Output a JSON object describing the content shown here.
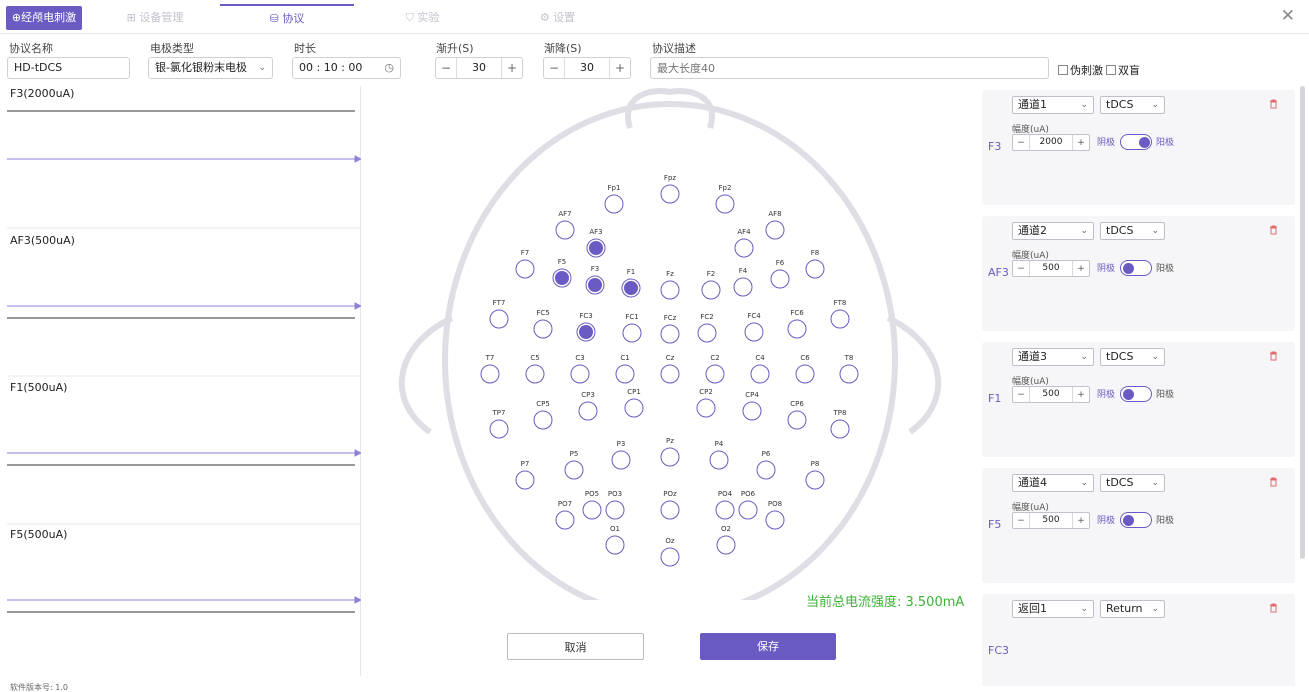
{
  "tabs": {
    "logo": "⊕经颅电刺激",
    "device": "⊞ 设备管理",
    "protocol": "⛁ 协议",
    "experiment": "⛉ 实验",
    "settings": "⚙ 设置",
    "close": "✕"
  },
  "form": {
    "name_label": "协议名称",
    "name_value": "HD-tDCS",
    "electrode_label": "电极类型",
    "electrode_value": "银-氯化银粉末电极",
    "duration_label": "时长",
    "duration_value": "00 : 10 : 00",
    "rampup_label": "渐升(S)",
    "rampup_value": "30",
    "rampdown_label": "渐降(S)",
    "rampdown_value": "30",
    "desc_label": "协议描述",
    "desc_placeholder": "最大长度40",
    "sham_label": "伪刺激",
    "double_blind_label": "双盲",
    "minus": "−",
    "plus": "+"
  },
  "waves": [
    {
      "label": "F3(2000uA)"
    },
    {
      "label": "AF3(500uA)"
    },
    {
      "label": "F1(500uA)"
    },
    {
      "label": "F5(500uA)"
    }
  ],
  "active_color": "#6a5bc2",
  "electrodes": [
    {
      "n": "Fpz",
      "a": false
    },
    {
      "n": "Fp1",
      "a": false
    },
    {
      "n": "Fp2",
      "a": false
    },
    {
      "n": "AF7",
      "a": false
    },
    {
      "n": "AF8",
      "a": false
    },
    {
      "n": "AF3",
      "a": true
    },
    {
      "n": "AF4",
      "a": false
    },
    {
      "n": "F7",
      "a": false
    },
    {
      "n": "F5",
      "a": true
    },
    {
      "n": "F3",
      "a": true
    },
    {
      "n": "F1",
      "a": true
    },
    {
      "n": "Fz",
      "a": false
    },
    {
      "n": "F2",
      "a": false
    },
    {
      "n": "F4",
      "a": false
    },
    {
      "n": "F6",
      "a": false
    },
    {
      "n": "F8",
      "a": false
    },
    {
      "n": "FT7",
      "a": false
    },
    {
      "n": "FC5",
      "a": false
    },
    {
      "n": "FC3",
      "a": true
    },
    {
      "n": "FC1",
      "a": false
    },
    {
      "n": "FCz",
      "a": false
    },
    {
      "n": "FC2",
      "a": false
    },
    {
      "n": "FC4",
      "a": false
    },
    {
      "n": "FC6",
      "a": false
    },
    {
      "n": "FT8",
      "a": false
    },
    {
      "n": "T7",
      "a": false
    },
    {
      "n": "C5",
      "a": false
    },
    {
      "n": "C3",
      "a": false
    },
    {
      "n": "C1",
      "a": false
    },
    {
      "n": "Cz",
      "a": false
    },
    {
      "n": "C2",
      "a": false
    },
    {
      "n": "C4",
      "a": false
    },
    {
      "n": "C6",
      "a": false
    },
    {
      "n": "T8",
      "a": false
    },
    {
      "n": "TP7",
      "a": false
    },
    {
      "n": "CP5",
      "a": false
    },
    {
      "n": "CP3",
      "a": false
    },
    {
      "n": "CP1",
      "a": false
    },
    {
      "n": "CP2",
      "a": false
    },
    {
      "n": "CP4",
      "a": false
    },
    {
      "n": "CP6",
      "a": false
    },
    {
      "n": "TP8",
      "a": false
    },
    {
      "n": "P7",
      "a": false
    },
    {
      "n": "P5",
      "a": false
    },
    {
      "n": "P3",
      "a": false
    },
    {
      "n": "Pz",
      "a": false
    },
    {
      "n": "P4",
      "a": false
    },
    {
      "n": "P6",
      "a": false
    },
    {
      "n": "P8",
      "a": false
    },
    {
      "n": "PO7",
      "a": false
    },
    {
      "n": "PO5",
      "a": false
    },
    {
      "n": "PO3",
      "a": false
    },
    {
      "n": "POz",
      "a": false
    },
    {
      "n": "PO4",
      "a": false
    },
    {
      "n": "PO6",
      "a": false
    },
    {
      "n": "PO8",
      "a": false
    },
    {
      "n": "O1",
      "a": false
    },
    {
      "n": "Oz",
      "a": false
    },
    {
      "n": "O2",
      "a": false
    }
  ],
  "total_current": "当前总电流强度: 3.500mA",
  "buttons": {
    "cancel": "取消",
    "save": "保存"
  },
  "channels": [
    {
      "site": "F3",
      "channel": "通道1",
      "mode": "tDCS",
      "amp_label": "幅度(uA)",
      "amp": "2000",
      "cathode": "阴极",
      "anode": "阳极",
      "polarity": "anode"
    },
    {
      "site": "AF3",
      "channel": "通道2",
      "mode": "tDCS",
      "amp_label": "幅度(uA)",
      "amp": "500",
      "cathode": "阴极",
      "anode": "阳极",
      "polarity": "cathode"
    },
    {
      "site": "F1",
      "channel": "通道3",
      "mode": "tDCS",
      "amp_label": "幅度(uA)",
      "amp": "500",
      "cathode": "阴极",
      "anode": "阳极",
      "polarity": "cathode"
    },
    {
      "site": "F5",
      "channel": "通道4",
      "mode": "tDCS",
      "amp_label": "幅度(uA)",
      "amp": "500",
      "cathode": "阴极",
      "anode": "阳极",
      "polarity": "cathode"
    },
    {
      "site": "FC3",
      "channel": "返回1",
      "mode": "Return"
    }
  ],
  "version": "软件版本号: 1.0"
}
